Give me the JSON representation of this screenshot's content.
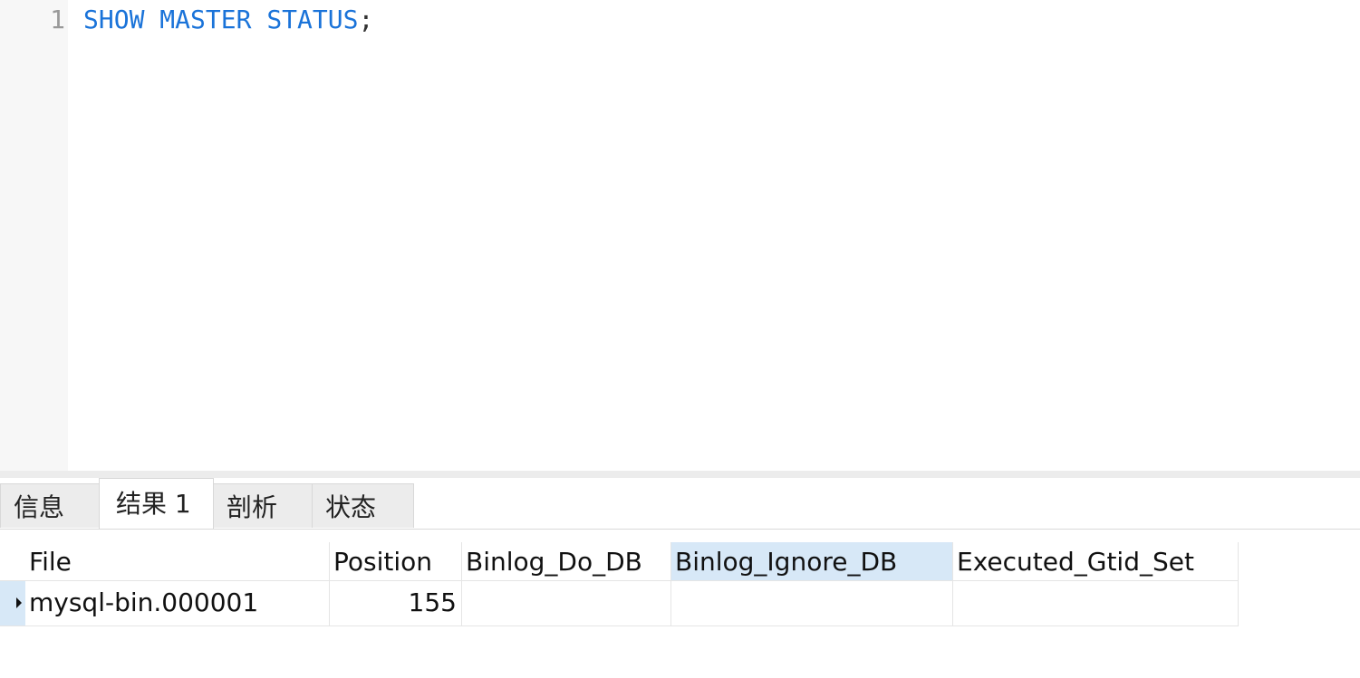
{
  "editor": {
    "line_number": "1",
    "code": {
      "keyword1": "SHOW",
      "keyword2": "MASTER",
      "keyword3": "STATUS",
      "terminator": ";"
    }
  },
  "tabs": [
    {
      "label": "信息",
      "active": false
    },
    {
      "label": "结果 1",
      "active": true
    },
    {
      "label": "剖析",
      "active": false
    },
    {
      "label": "状态",
      "active": false
    }
  ],
  "result_grid": {
    "columns": [
      "File",
      "Position",
      "Binlog_Do_DB",
      "Binlog_Ignore_DB",
      "Executed_Gtid_Set"
    ],
    "selected_column": "Binlog_Ignore_DB",
    "rows": [
      [
        "mysql-bin.000001",
        "155",
        "",
        "",
        ""
      ]
    ]
  },
  "colors": {
    "keyword": "#1a73d9",
    "selection": "#d7e8f7",
    "gutter": "#f7f7f7"
  }
}
